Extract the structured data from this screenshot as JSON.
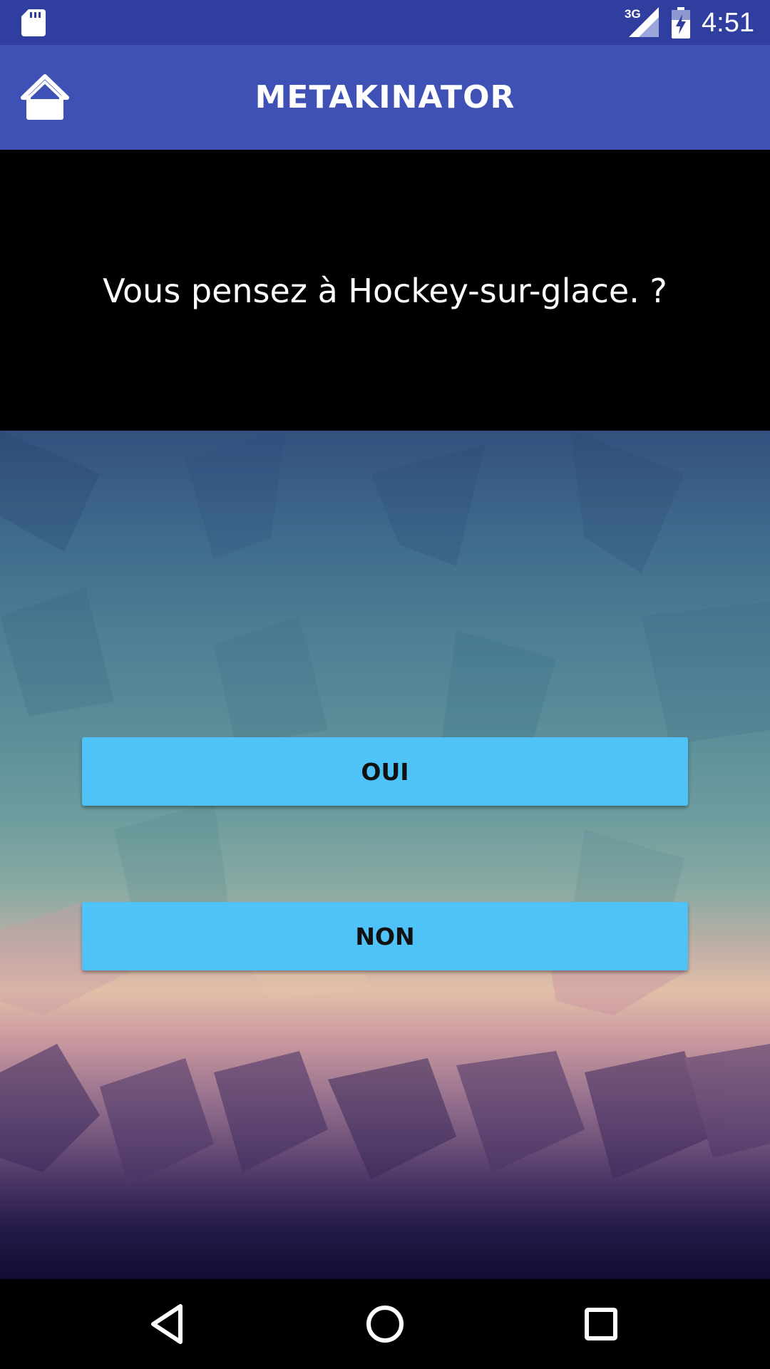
{
  "status_bar": {
    "time": "4:51",
    "network_label": "3G",
    "icons": [
      "sd-card-icon",
      "signal-icon",
      "battery-charging-icon"
    ]
  },
  "app_bar": {
    "title": "METAKINATOR",
    "home_icon": "home-icon"
  },
  "question": {
    "text": "Vous pensez à Hockey-sur-glace. ?"
  },
  "answers": {
    "yes_label": "OUI",
    "no_label": "NON"
  },
  "nav_bar": {
    "icons": [
      "back-icon",
      "home-circle-icon",
      "recents-icon"
    ]
  },
  "colors": {
    "status_bar": "#303f9f",
    "app_bar": "#3f51b5",
    "button": "#4fc3f7",
    "question_bg": "#000000"
  }
}
